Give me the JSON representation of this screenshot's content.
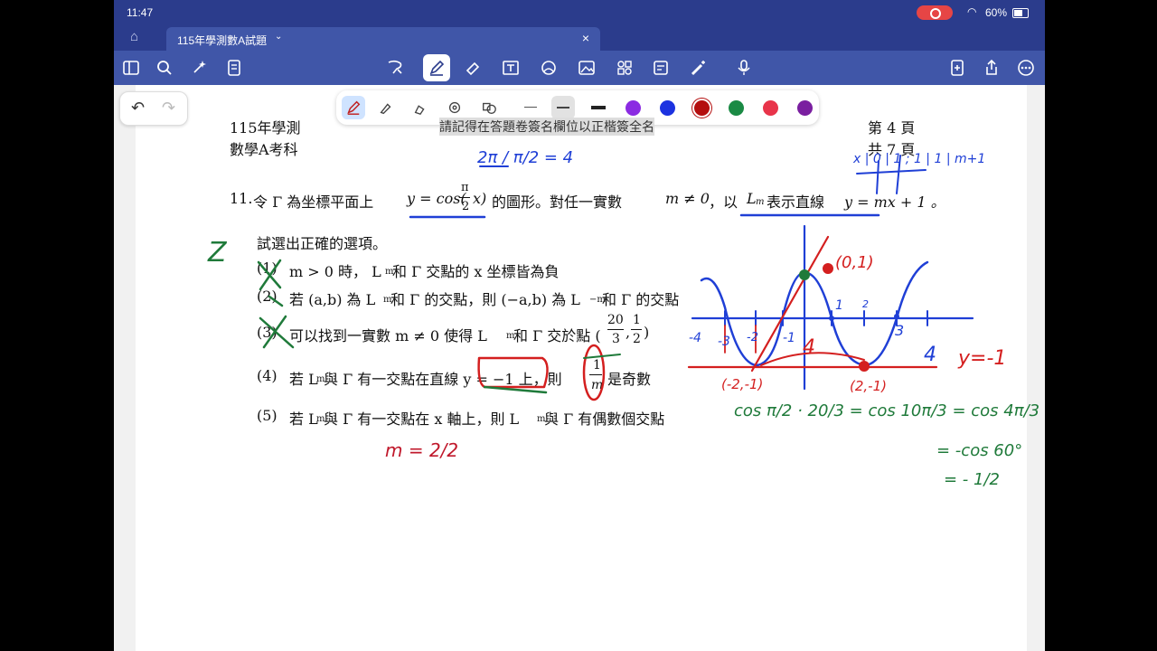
{
  "status": {
    "time": "11:47",
    "battery": "60%"
  },
  "tab": {
    "title": "115年學測數A試題"
  },
  "header": {
    "exam_year": "115年學測",
    "subject": "數學A考科",
    "page_label": "第 4 頁",
    "total_label": "共 7 頁",
    "banner": "請記得在答題卷簽名欄位以正楷簽全名"
  },
  "question": {
    "number": "11.",
    "line1_a": "令 Γ 為坐標平面上",
    "line1_eq": "y = cos(",
    "pi": "π",
    "two": "2",
    "x_close": "x)",
    "line1_b": "的圖形。對任一實數",
    "m_ne_0": "m ≠ 0",
    "line1_c": "，以",
    "Lm": "L",
    "sub_m": "m",
    "line1_d": "表示直線",
    "line1_eq2": "y = mx + 1 。",
    "line2": "試選出正確的選項。",
    "options": [
      {
        "label": "(1)",
        "text": "m > 0 時， L",
        "sub": "m",
        "text2": " 和 Γ 交點的 x 坐標皆為負"
      },
      {
        "label": "(2)",
        "text": "若 (a,b) 為 L",
        "sub": "m",
        "text2": " 和 Γ 的交點，則 (−a,b) 為 L",
        "sub2": "−m",
        "text3": " 和 Γ 的交點"
      },
      {
        "label": "(3)",
        "text": "可以找到一實數 m ≠ 0 使得 L",
        "sub": "m",
        "text2": " 和 Γ 交於點 (",
        "frac1_n": "20",
        "frac1_d": "3",
        "frac2_n": "1",
        "frac2_d": "2",
        "text3": ")"
      },
      {
        "label": "(4)",
        "text": "若 L",
        "sub": "m",
        "text2": " 與 Γ 有一交點在直線 y = −1 上，則",
        "frac_n": "1",
        "frac_d": "m",
        "text3": "是奇數"
      },
      {
        "label": "(5)",
        "text": "若 L",
        "sub": "m",
        "text2": " 與 Γ 有一交點在 x 軸上，則 L",
        "sub2": "m",
        "text3": " 與 Γ 有偶數個交點"
      }
    ]
  },
  "handwriting": {
    "z": "Z",
    "period": "2π / π/2 = 4",
    "table": "x | 0 | 1 ; 1 | 1 | m+1",
    "point_01": "(0,1)",
    "point_neg2": "(-2,-1)",
    "point_2": "(2,-1)",
    "yneg1": "y=-1",
    "four_r": "4",
    "four_c": "4",
    "m_eq": "m = 2/2",
    "cos_line": "cos π/2 · 20/3 = cos 10π/3 = cos 4π/3",
    "cos60": "= -cos 60°",
    "half": "= - 1/2",
    "axis_nums": [
      "-4",
      "-3",
      "-2",
      "-1",
      "1",
      "2",
      "3"
    ]
  },
  "colors": {
    "ink_blue": "#1f3fd6",
    "ink_red": "#d41f1f",
    "ink_green": "#1f7a3a",
    "toolbar": "#4056a8",
    "statusbar": "#2b3c8c"
  },
  "pen_colors": [
    "#555555",
    "#111111",
    "#8b2be2",
    "#1c32e0",
    "#b40f0f",
    "#1a8a44",
    "#e8344a",
    "#7a1fa0"
  ]
}
